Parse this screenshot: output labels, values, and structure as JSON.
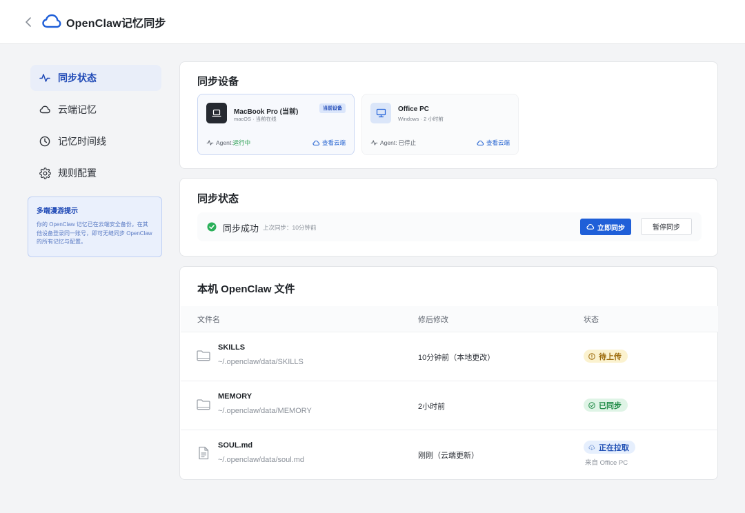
{
  "app": {
    "title": "OpenClaw记忆同步"
  },
  "sidebar": {
    "items": [
      {
        "label": "同步状态",
        "icon": "activity-icon",
        "active": true
      },
      {
        "label": "云端记忆",
        "icon": "cloud-icon",
        "active": false
      },
      {
        "label": "记忆时间线",
        "icon": "clock-icon",
        "active": false
      },
      {
        "label": "规则配置",
        "icon": "gear-icon",
        "active": false
      }
    ],
    "tip": {
      "title": "多端漫游提示",
      "body": "你的 OpenClaw 记忆已在云端安全备份。在其他设备登录同一账号，即可无缝同步 OpenClaw 的所有记忆与配置。"
    }
  },
  "devices": {
    "title": "同步设备",
    "items": [
      {
        "name": "MacBook Pro (当前)",
        "sub": "macOS · 当前在线",
        "badge": "当前设备",
        "agent_label": "Agent:",
        "agent_status": "运行中",
        "view_label": "查看云端",
        "icon": "laptop-icon"
      },
      {
        "name": "Office PC",
        "sub": "Windows · 2 小时前",
        "agent_label": "Agent:",
        "agent_status": "已停止",
        "view_label": "查看云端",
        "icon": "monitor-icon"
      }
    ]
  },
  "sync_status": {
    "title": "同步状态",
    "status": "同步成功",
    "last_sync": "上次同步：10分钟前",
    "sync_now_label": "立即同步",
    "pause_label": "暂停同步"
  },
  "files": {
    "title": "本机 OpenClaw 文件",
    "columns": [
      "文件名",
      "修后修改",
      "状态"
    ],
    "rows": [
      {
        "name": "SKILLS",
        "path": "~/.openclaw/data/SKILLS",
        "modified": "10分钟前（本地更改）",
        "status": "待上传",
        "status_sub": "",
        "type": "folder"
      },
      {
        "name": "MEMORY",
        "path": "~/.openclaw/data/MEMORY",
        "modified": "2小时前",
        "status": "已同步",
        "status_sub": "",
        "type": "folder"
      },
      {
        "name": "SOUL.md",
        "path": "~/.openclaw/data/soul.md",
        "modified": "刚刚（云端更新）",
        "status": "正在拉取",
        "status_sub": "来自 Office PC",
        "type": "file"
      }
    ]
  },
  "colors": {
    "accent": "#1f5fd8",
    "success": "#2bb05a",
    "warning": "#9c6a0b"
  }
}
